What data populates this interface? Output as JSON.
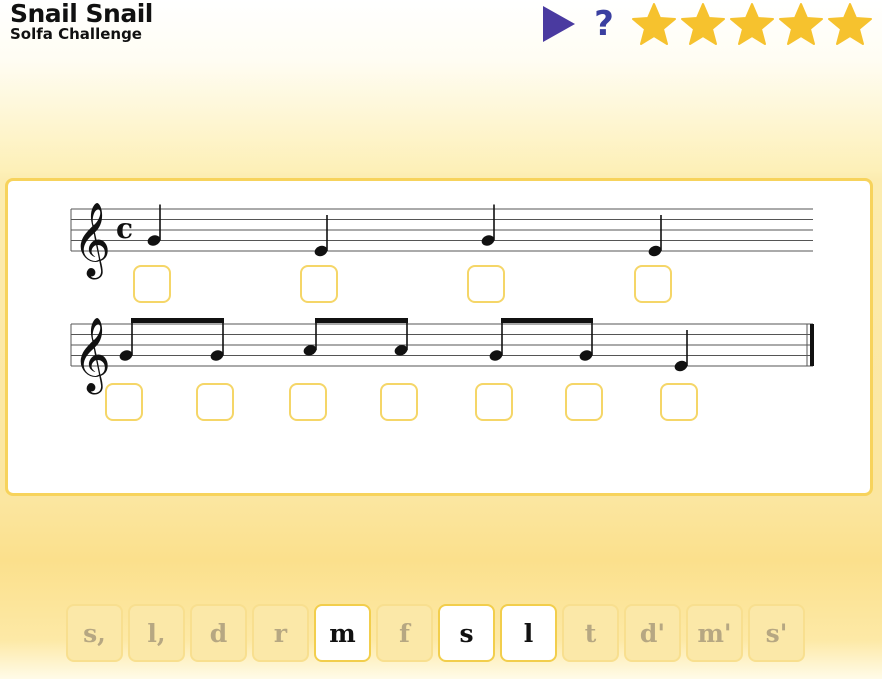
{
  "header": {
    "title": "Snail Snail",
    "subtitle": "Solfa Challenge"
  },
  "controls": {
    "play_icon": "play-icon",
    "help_label": "?",
    "stars": [
      {
        "icon": "star-icon",
        "filled": true
      },
      {
        "icon": "star-icon",
        "filled": true
      },
      {
        "icon": "star-icon",
        "filled": true
      },
      {
        "icon": "star-icon",
        "filled": true
      },
      {
        "icon": "star-icon",
        "filled": true
      }
    ]
  },
  "score": {
    "clef": "treble",
    "time_signature": "c",
    "line1": {
      "notes": [
        {
          "pitch": "G4",
          "duration": "quarter"
        },
        {
          "pitch": "E4",
          "duration": "quarter"
        },
        {
          "pitch": "G4",
          "duration": "quarter"
        },
        {
          "pitch": "E4",
          "duration": "quarter"
        }
      ]
    },
    "line2": {
      "notes": [
        {
          "pitch": "G4",
          "duration": "eighth"
        },
        {
          "pitch": "G4",
          "duration": "eighth"
        },
        {
          "pitch": "A4",
          "duration": "eighth"
        },
        {
          "pitch": "A4",
          "duration": "eighth"
        },
        {
          "pitch": "G4",
          "duration": "eighth"
        },
        {
          "pitch": "G4",
          "duration": "eighth"
        },
        {
          "pitch": "E4",
          "duration": "quarter"
        }
      ]
    },
    "answers_line1": [
      "",
      "",
      "",
      ""
    ],
    "answers_line2": [
      "",
      "",
      "",
      "",
      "",
      "",
      ""
    ]
  },
  "keyboard": {
    "keys": [
      {
        "label": "s,",
        "enabled": false
      },
      {
        "label": "l,",
        "enabled": false
      },
      {
        "label": "d",
        "enabled": false
      },
      {
        "label": "r",
        "enabled": false
      },
      {
        "label": "m",
        "enabled": true
      },
      {
        "label": "f",
        "enabled": false
      },
      {
        "label": "s",
        "enabled": true
      },
      {
        "label": "l",
        "enabled": true
      },
      {
        "label": "t",
        "enabled": false
      },
      {
        "label": "d'",
        "enabled": false
      },
      {
        "label": "m'",
        "enabled": false
      },
      {
        "label": "s'",
        "enabled": false
      }
    ]
  },
  "colors": {
    "play": "#4a3aa0",
    "help": "#3a3fa0",
    "star": "#f6c22e",
    "box_border": "#f5d668",
    "panel_border": "#f7d35c"
  }
}
